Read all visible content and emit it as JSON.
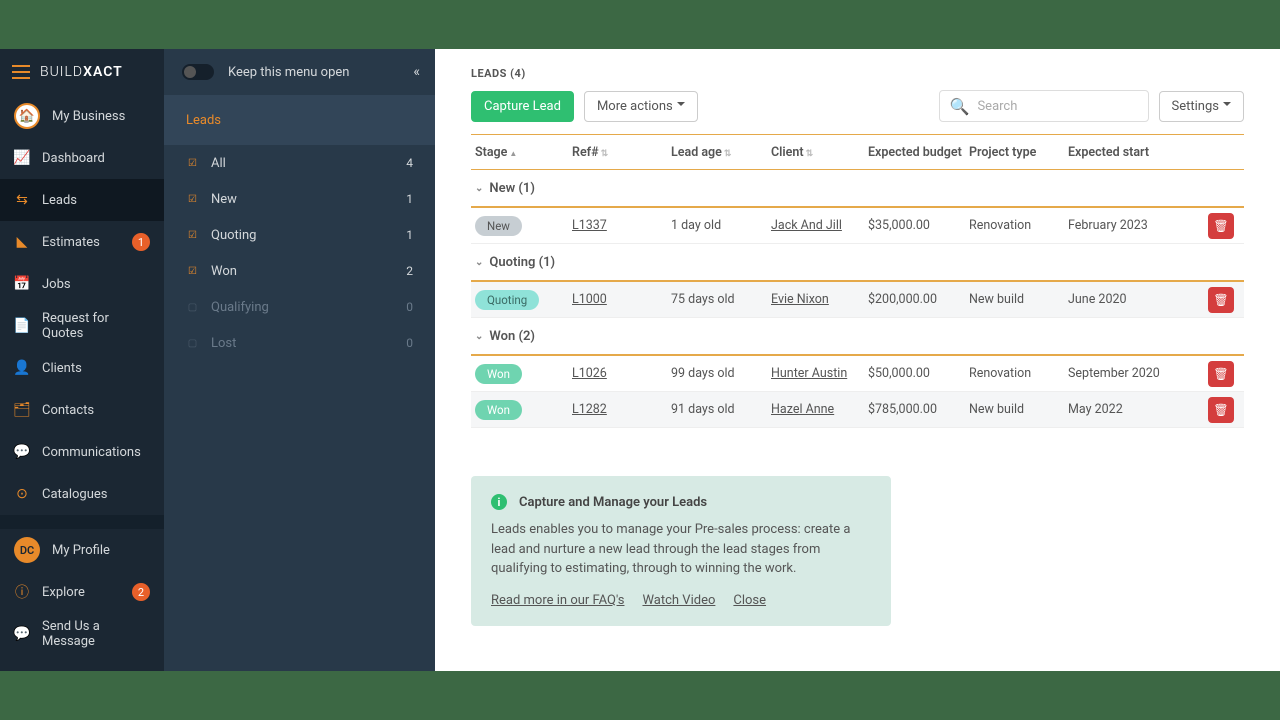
{
  "brand": {
    "thin": "BUILD",
    "bold": "XACT"
  },
  "biz_label": "My Business",
  "nav": [
    {
      "icon": "📈",
      "label": "Dashboard",
      "badge": null,
      "active": false
    },
    {
      "icon": "⇆",
      "label": "Leads",
      "badge": null,
      "active": true
    },
    {
      "icon": "◣",
      "label": "Estimates",
      "badge": "1",
      "active": false
    },
    {
      "icon": "📅",
      "label": "Jobs",
      "badge": null,
      "active": false
    },
    {
      "icon": "📄",
      "label": "Request for Quotes",
      "badge": null,
      "active": false
    },
    {
      "icon": "👤",
      "label": "Clients",
      "badge": null,
      "active": false
    },
    {
      "icon": "🗂",
      "label": "Contacts",
      "badge": null,
      "active": false
    },
    {
      "icon": "💬",
      "label": "Communications",
      "badge": null,
      "active": false
    },
    {
      "icon": "⊙",
      "label": "Catalogues",
      "badge": null,
      "active": false
    }
  ],
  "profile": {
    "initials": "DC",
    "label": "My Profile"
  },
  "nav_tail": [
    {
      "icon": "ⓘ",
      "label": "Explore",
      "badge": "2"
    },
    {
      "icon": "💬",
      "label": "Send Us a Message",
      "badge": null
    }
  ],
  "sub": {
    "keep_open": "Keep this menu open",
    "title": "Leads",
    "items": [
      {
        "label": "All",
        "count": "4",
        "on": true,
        "dim": false
      },
      {
        "label": "New",
        "count": "1",
        "on": true,
        "dim": false
      },
      {
        "label": "Quoting",
        "count": "1",
        "on": true,
        "dim": false
      },
      {
        "label": "Won",
        "count": "2",
        "on": true,
        "dim": false
      },
      {
        "label": "Qualifying",
        "count": "0",
        "on": false,
        "dim": true
      },
      {
        "label": "Lost",
        "count": "0",
        "on": false,
        "dim": true
      }
    ]
  },
  "leads_header": "LEADS (4)",
  "actions": {
    "capture": "Capture Lead",
    "more": "More actions",
    "search_placeholder": "Search",
    "settings": "Settings"
  },
  "columns": {
    "stage": "Stage",
    "ref": "Ref#",
    "age": "Lead age",
    "client": "Client",
    "budget": "Expected budget",
    "type": "Project type",
    "start": "Expected start"
  },
  "groups": [
    {
      "title": "New (1)",
      "rows": [
        {
          "stage": "New",
          "stage_class": "new",
          "ref": "L1337",
          "age": "1 day old",
          "client": "Jack And Jill",
          "budget": "$35,000.00",
          "type": "Renovation",
          "start": "February 2023",
          "alt": false
        }
      ]
    },
    {
      "title": "Quoting (1)",
      "rows": [
        {
          "stage": "Quoting",
          "stage_class": "quoting",
          "ref": "L1000",
          "age": "75 days old",
          "client": "Evie Nixon",
          "budget": "$200,000.00",
          "type": "New build",
          "start": "June 2020",
          "alt": true
        }
      ]
    },
    {
      "title": "Won (2)",
      "rows": [
        {
          "stage": "Won",
          "stage_class": "won",
          "ref": "L1026",
          "age": "99 days old",
          "client": "Hunter Austin",
          "budget": "$50,000.00",
          "type": "Renovation",
          "start": "September 2020",
          "alt": false
        },
        {
          "stage": "Won",
          "stage_class": "won",
          "ref": "L1282",
          "age": "91 days old",
          "client": "Hazel Anne",
          "budget": "$785,000.00",
          "type": "New build",
          "start": "May 2022",
          "alt": true
        }
      ]
    }
  ],
  "info": {
    "title": "Capture and Manage your Leads",
    "body": "Leads enables you to manage your Pre-sales process: create a lead and nurture a new lead through the lead stages from qualifying to estimating, through to winning the work.",
    "links": {
      "faq": "Read more in our FAQ's",
      "video": "Watch Video",
      "close": "Close"
    }
  }
}
